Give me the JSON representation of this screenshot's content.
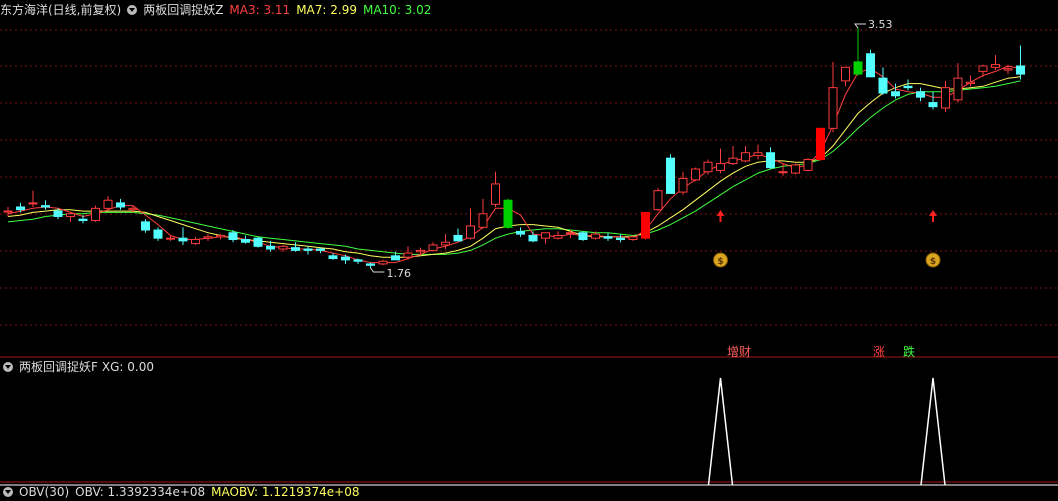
{
  "header": {
    "title": "东方海洋(日线,前复权)",
    "indicator": "两板回调捉妖Z",
    "ma3_label": "MA3: 3.11",
    "ma7_label": "MA7: 2.99",
    "ma10_label": "MA10: 3.02"
  },
  "sub_header": {
    "indicator": "两板回调捉妖F",
    "xg_label": "XG: 0.00"
  },
  "bottom_header": {
    "obv_label": "OBV(30)",
    "obv_value": "OBV: 1.3392334e+08",
    "maobv_value": "MAOBV: 1.1219374e+08"
  },
  "signals": {
    "zengcai": "增财",
    "zhang": "涨",
    "die": "跌"
  },
  "colors": {
    "up": "#ff3b3b",
    "down": "#54ffff",
    "ma3": "#ff4040",
    "ma7": "#ffff60",
    "ma10": "#40ff40",
    "grid": "#7a1010",
    "limit_up": "#ff0000",
    "limit_down": "#00d000"
  },
  "chart_data": {
    "type": "candlestick",
    "extremes": {
      "high_label": "3.53",
      "low_label": "1.76",
      "high": 3.53,
      "low": 1.76
    },
    "candles": [
      [
        2.18,
        2.21,
        2.14,
        2.18
      ],
      [
        2.21,
        2.24,
        2.17,
        2.19
      ],
      [
        2.24,
        2.33,
        2.21,
        2.24
      ],
      [
        2.22,
        2.26,
        2.19,
        2.21
      ],
      [
        2.18,
        2.2,
        2.12,
        2.14
      ],
      [
        2.14,
        2.17,
        2.1,
        2.16
      ],
      [
        2.12,
        2.15,
        2.09,
        2.11
      ],
      [
        2.11,
        2.22,
        2.1,
        2.2
      ],
      [
        2.2,
        2.29,
        2.18,
        2.26
      ],
      [
        2.24,
        2.27,
        2.19,
        2.21
      ],
      [
        2.19,
        2.22,
        2.17,
        2.2
      ],
      [
        2.1,
        2.12,
        2.02,
        2.04
      ],
      [
        2.04,
        2.06,
        1.96,
        1.98
      ],
      [
        1.98,
        2.0,
        1.96,
        1.98
      ],
      [
        1.98,
        2.06,
        1.93,
        1.96
      ],
      [
        1.94,
        1.99,
        1.93,
        1.97
      ],
      [
        1.98,
        2.01,
        1.96,
        1.99
      ],
      [
        1.99,
        2.01,
        1.97,
        2.0
      ],
      [
        2.02,
        2.04,
        1.95,
        1.97
      ],
      [
        1.97,
        2.0,
        1.94,
        1.95
      ],
      [
        1.98,
        1.99,
        1.91,
        1.92
      ],
      [
        1.92,
        1.96,
        1.88,
        1.9
      ],
      [
        1.9,
        1.93,
        1.88,
        1.92
      ],
      [
        1.91,
        1.95,
        1.88,
        1.89
      ],
      [
        1.9,
        1.92,
        1.86,
        1.89
      ],
      [
        1.9,
        1.91,
        1.87,
        1.89
      ],
      [
        1.85,
        1.87,
        1.82,
        1.83
      ],
      [
        1.84,
        1.86,
        1.79,
        1.82
      ],
      [
        1.82,
        1.83,
        1.79,
        1.81
      ],
      [
        1.79,
        1.8,
        1.76,
        1.78
      ],
      [
        1.79,
        1.82,
        1.78,
        1.81
      ],
      [
        1.85,
        1.88,
        1.82,
        1.82
      ],
      [
        1.84,
        1.92,
        1.82,
        1.87
      ],
      [
        1.88,
        1.91,
        1.86,
        1.89
      ],
      [
        1.89,
        1.95,
        1.88,
        1.93
      ],
      [
        1.93,
        2.01,
        1.9,
        1.95
      ],
      [
        2.0,
        2.05,
        1.96,
        1.96
      ],
      [
        1.98,
        2.2,
        1.97,
        2.07
      ],
      [
        2.06,
        2.27,
        2.05,
        2.16
      ],
      [
        2.23,
        2.47,
        2.21,
        2.38
      ],
      [
        2.26,
        2.27,
        2.05,
        2.06
      ],
      [
        2.03,
        2.06,
        1.99,
        2.01
      ],
      [
        2.0,
        2.03,
        1.95,
        1.96
      ],
      [
        1.98,
        2.0,
        1.94,
        2.02
      ],
      [
        1.98,
        2.03,
        1.97,
        2.0
      ],
      [
        2.02,
        2.04,
        1.98,
        2.02
      ],
      [
        2.02,
        2.03,
        1.96,
        1.97
      ],
      [
        1.98,
        2.03,
        1.97,
        2.01
      ],
      [
        1.99,
        2.02,
        1.96,
        1.98
      ],
      [
        1.98,
        2.01,
        1.95,
        1.97
      ],
      [
        1.97,
        2.0,
        1.96,
        1.99
      ],
      [
        1.98,
        2.17,
        1.97,
        2.17
      ],
      [
        2.19,
        2.35,
        2.18,
        2.33
      ],
      [
        2.57,
        2.6,
        2.31,
        2.31
      ],
      [
        2.32,
        2.47,
        2.3,
        2.42
      ],
      [
        2.41,
        2.5,
        2.4,
        2.49
      ],
      [
        2.47,
        2.56,
        2.45,
        2.54
      ],
      [
        2.48,
        2.64,
        2.46,
        2.53
      ],
      [
        2.53,
        2.66,
        2.52,
        2.57
      ],
      [
        2.55,
        2.66,
        2.54,
        2.61
      ],
      [
        2.59,
        2.67,
        2.56,
        2.61
      ],
      [
        2.61,
        2.65,
        2.49,
        2.5
      ],
      [
        2.47,
        2.53,
        2.44,
        2.47
      ],
      [
        2.46,
        2.53,
        2.45,
        2.52
      ],
      [
        2.48,
        2.57,
        2.47,
        2.56
      ],
      [
        2.56,
        2.79,
        2.55,
        2.79
      ],
      [
        2.79,
        3.28,
        2.76,
        3.09
      ],
      [
        3.14,
        3.24,
        3.1,
        3.24
      ],
      [
        3.19,
        3.53,
        3.18,
        3.28
      ],
      [
        3.34,
        3.37,
        3.17,
        3.17
      ],
      [
        3.16,
        3.24,
        3.04,
        3.05
      ],
      [
        3.06,
        3.12,
        3.01,
        3.03
      ],
      [
        3.1,
        3.15,
        3.07,
        3.09
      ],
      [
        3.06,
        3.09,
        2.99,
        3.02
      ],
      [
        2.98,
        3.06,
        2.93,
        2.95
      ],
      [
        2.94,
        3.14,
        2.91,
        3.09
      ],
      [
        3.0,
        3.27,
        2.98,
        3.16
      ],
      [
        3.12,
        3.18,
        3.1,
        3.13
      ],
      [
        3.21,
        3.26,
        3.17,
        3.25
      ],
      [
        3.24,
        3.33,
        3.22,
        3.26
      ],
      [
        3.22,
        3.26,
        3.19,
        3.23
      ],
      [
        3.25,
        3.4,
        3.15,
        3.19
      ]
    ],
    "ma3": [
      2.16,
      2.18,
      2.2,
      2.21,
      2.2,
      2.17,
      2.14,
      2.16,
      2.19,
      2.22,
      2.22,
      2.15,
      2.08,
      2.0,
      1.97,
      1.97,
      1.98,
      1.99,
      1.99,
      1.97,
      1.95,
      1.92,
      1.91,
      1.9,
      1.9,
      1.89,
      1.87,
      1.85,
      1.82,
      1.8,
      1.8,
      1.8,
      1.83,
      1.86,
      1.9,
      1.92,
      1.95,
      1.99,
      2.06,
      2.2,
      2.2,
      2.15,
      2.01,
      2.0,
      1.99,
      2.01,
      2.0,
      2.0,
      1.99,
      1.99,
      1.98,
      2.04,
      2.16,
      2.27,
      2.35,
      2.41,
      2.48,
      2.52,
      2.55,
      2.57,
      2.6,
      2.57,
      2.53,
      2.5,
      2.52,
      2.62,
      2.81,
      3.04,
      3.2,
      3.23,
      3.17,
      3.08,
      3.06,
      3.05,
      3.02,
      3.02,
      3.07,
      3.13,
      3.18,
      3.21,
      3.25,
      3.23
    ],
    "ma7": [
      2.14,
      2.15,
      2.17,
      2.18,
      2.19,
      2.19,
      2.18,
      2.18,
      2.18,
      2.18,
      2.18,
      2.17,
      2.14,
      2.11,
      2.08,
      2.05,
      2.02,
      2.0,
      1.98,
      1.97,
      1.96,
      1.95,
      1.94,
      1.93,
      1.92,
      1.91,
      1.9,
      1.88,
      1.87,
      1.85,
      1.84,
      1.84,
      1.84,
      1.85,
      1.86,
      1.87,
      1.89,
      1.92,
      1.98,
      2.05,
      2.07,
      2.08,
      2.08,
      2.07,
      2.06,
      2.03,
      2.0,
      1.99,
      1.99,
      1.99,
      1.99,
      2.02,
      2.07,
      2.13,
      2.19,
      2.26,
      2.33,
      2.4,
      2.46,
      2.51,
      2.54,
      2.55,
      2.55,
      2.54,
      2.54,
      2.57,
      2.66,
      2.78,
      2.9,
      2.98,
      3.05,
      3.09,
      3.12,
      3.12,
      3.1,
      3.08,
      3.08,
      3.09,
      3.1,
      3.13,
      3.16,
      3.17
    ],
    "ma10": [
      2.1,
      2.11,
      2.12,
      2.14,
      2.15,
      2.16,
      2.16,
      2.17,
      2.17,
      2.17,
      2.17,
      2.16,
      2.15,
      2.13,
      2.11,
      2.09,
      2.07,
      2.05,
      2.03,
      2.01,
      1.99,
      1.98,
      1.97,
      1.96,
      1.95,
      1.94,
      1.93,
      1.92,
      1.9,
      1.89,
      1.88,
      1.87,
      1.86,
      1.86,
      1.86,
      1.86,
      1.87,
      1.89,
      1.93,
      1.98,
      2.01,
      2.03,
      2.04,
      2.05,
      2.05,
      2.04,
      2.03,
      2.02,
      2.02,
      2.01,
      2.0,
      2.01,
      2.04,
      2.08,
      2.13,
      2.18,
      2.24,
      2.3,
      2.36,
      2.41,
      2.46,
      2.49,
      2.51,
      2.52,
      2.53,
      2.56,
      2.62,
      2.7,
      2.79,
      2.87,
      2.94,
      3.0,
      3.04,
      3.06,
      3.06,
      3.06,
      3.07,
      3.08,
      3.09,
      3.1,
      3.12,
      3.14
    ],
    "limit_up_index": [
      51,
      65
    ],
    "limit_down_index": [
      40,
      68
    ],
    "zhang_arrows": [
      57,
      74
    ],
    "money_bags": [
      57,
      74
    ],
    "xg_pulses": [
      57,
      74
    ]
  }
}
